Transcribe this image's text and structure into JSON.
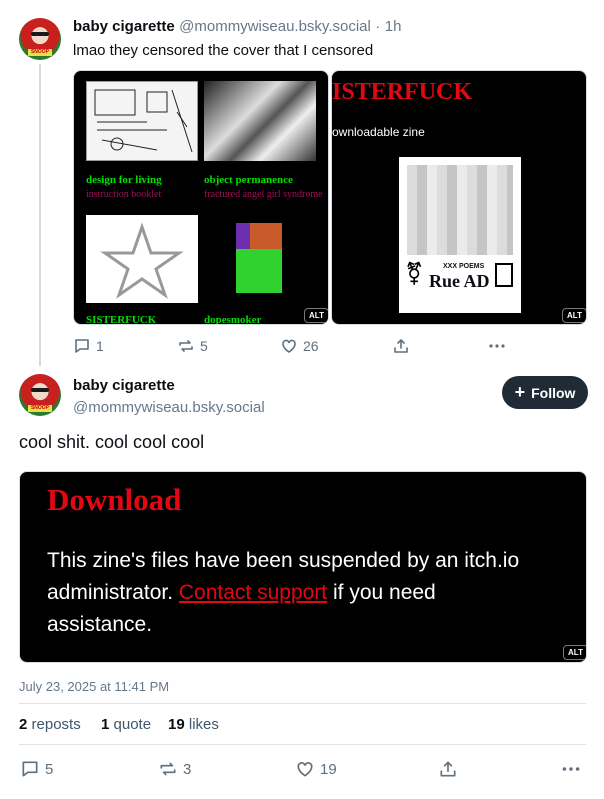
{
  "reply_post": {
    "author_name": "baby cigarette",
    "author_handle": "@mommywiseau.bsky.social",
    "separator": "·",
    "time": "1h",
    "text": "lmao they censored the cover that I censored",
    "image_left": {
      "item1_title": "design for living",
      "item1_sub": "instruction booklet",
      "item2_title": "object permanence",
      "item2_sub": "fractured angel girl syndrome",
      "item3_title": "SISTERFUCK",
      "item4_title": "dopesmoker",
      "alt_label": "ALT"
    },
    "image_right": {
      "title": "ISTERFUCK",
      "subtitle": "ownloadable zine",
      "cover_top": "XXX POEMS",
      "cover_name": "Rue AD",
      "alt_label": "ALT"
    },
    "actions": {
      "replies": "1",
      "reposts": "5",
      "likes": "26"
    }
  },
  "main_post": {
    "author_name": "baby cigarette",
    "author_handle": "@mommywiseau.bsky.social",
    "follow_label": "Follow",
    "text": "cool shit. cool cool cool",
    "image": {
      "heading": "Download",
      "msg_before": "This zine's files have been suspended by an itch.io administrator. ",
      "msg_link": "Contact support",
      "msg_after": " if you need assistance.",
      "alt_label": "ALT"
    },
    "timestamp": "July 23, 2025 at 11:41 PM",
    "stats": {
      "reposts_count": "2",
      "reposts_label": "reposts",
      "quotes_count": "1",
      "quotes_label": "quote",
      "likes_count": "19",
      "likes_label": "likes"
    },
    "actions": {
      "replies": "5",
      "reposts": "3",
      "likes": "19"
    }
  },
  "colors": {
    "accent_red": "#e30613",
    "follow_bg": "#202b36",
    "muted": "#66788a"
  }
}
